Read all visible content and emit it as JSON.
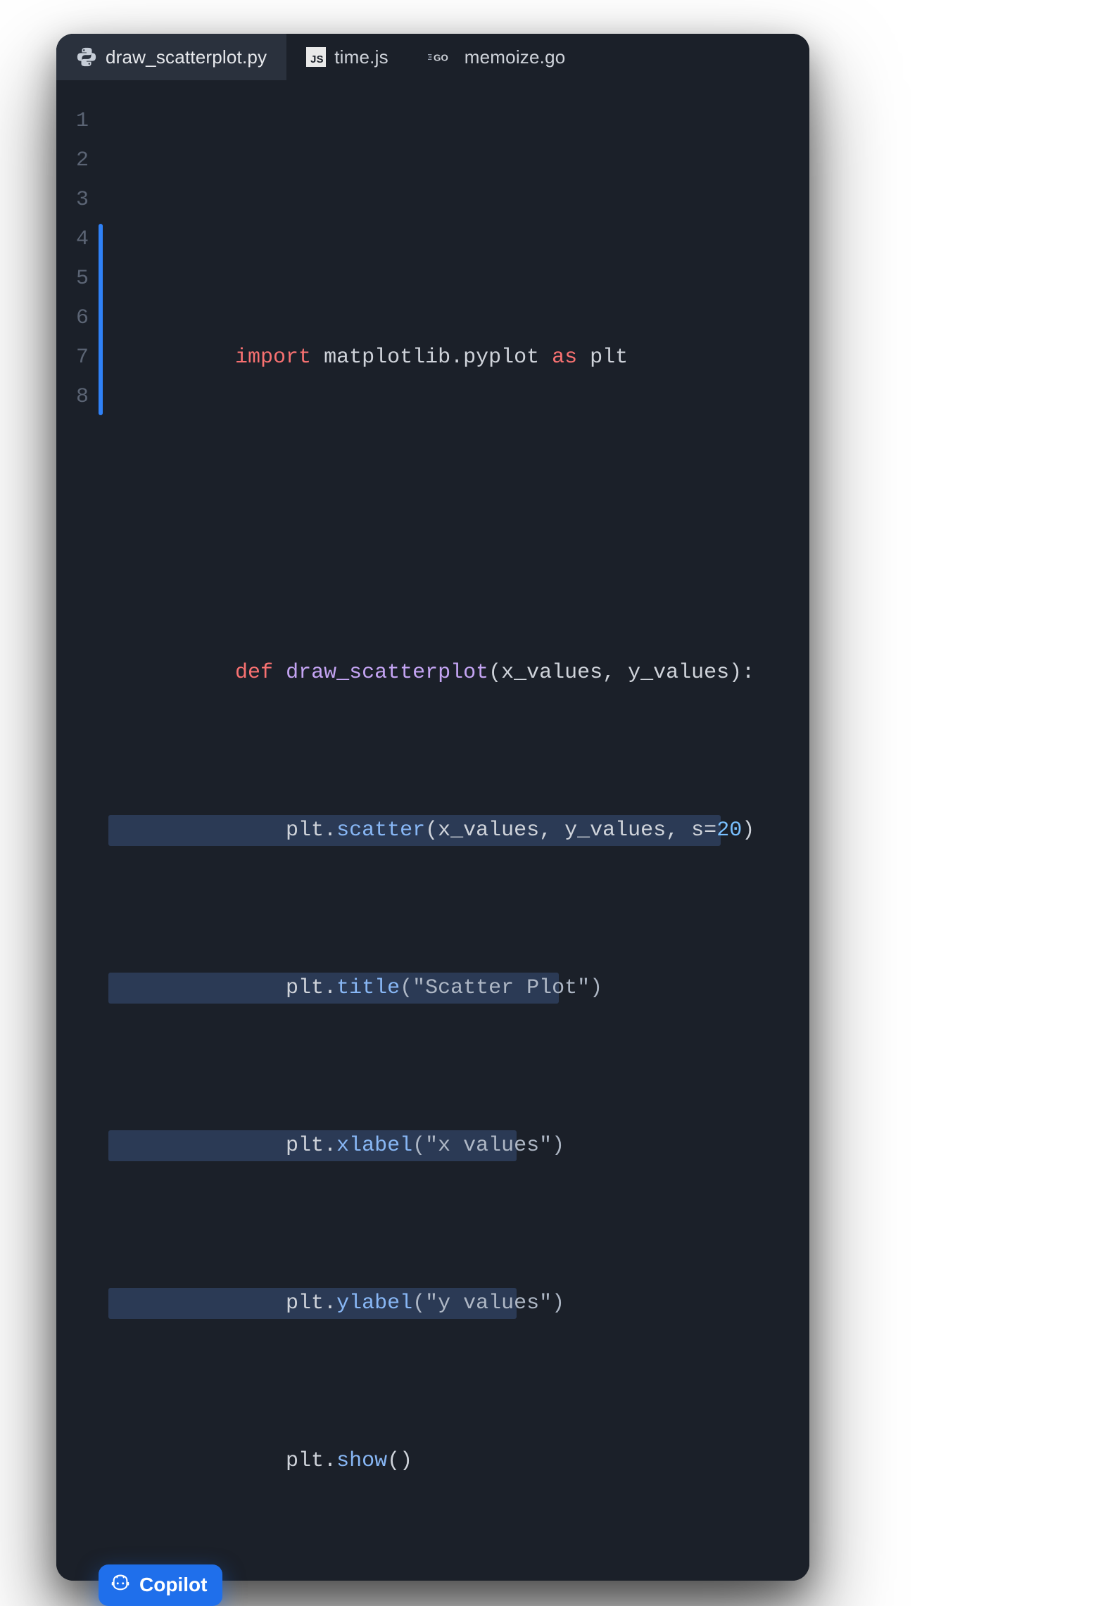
{
  "tabs": [
    {
      "label": "draw_scatterplot.py",
      "lang": "python",
      "active": true
    },
    {
      "label": "time.js",
      "lang": "js",
      "active": false
    },
    {
      "label": "memoize.go",
      "lang": "go",
      "active": false
    }
  ],
  "gutter": {
    "start": 1,
    "end": 8
  },
  "code": {
    "line1": {
      "kw": "import",
      "rest": " matplotlib.pyplot ",
      "as": "as",
      "alias": " plt"
    },
    "line2": "",
    "line3": {
      "def": "def",
      "sp": " ",
      "fn": "draw_scatterplot",
      "args": "(x_values, y_values):"
    },
    "line4": {
      "indent": "    ",
      "obj": "plt.",
      "fn": "scatter",
      "open": "(x_values, y_values, s",
      "eq": "=",
      "num": "20",
      "close": ")"
    },
    "line5": {
      "indent": "    ",
      "obj": "plt.",
      "fn": "title",
      "args": "(\"Scatter Plot\")"
    },
    "line6": {
      "indent": "    ",
      "obj": "plt.",
      "fn": "xlabel",
      "args": "(\"x values\")"
    },
    "line7": {
      "indent": "    ",
      "obj": "plt.",
      "fn": "ylabel",
      "args": "(\"y values\")"
    },
    "line8": {
      "indent": "    ",
      "obj": "plt.",
      "fn": "show",
      "args": "()"
    }
  },
  "copilot": {
    "label": "Copilot"
  },
  "suggestion": {
    "fromLine": 4,
    "toLine": 8,
    "highlightedTo": 7
  }
}
